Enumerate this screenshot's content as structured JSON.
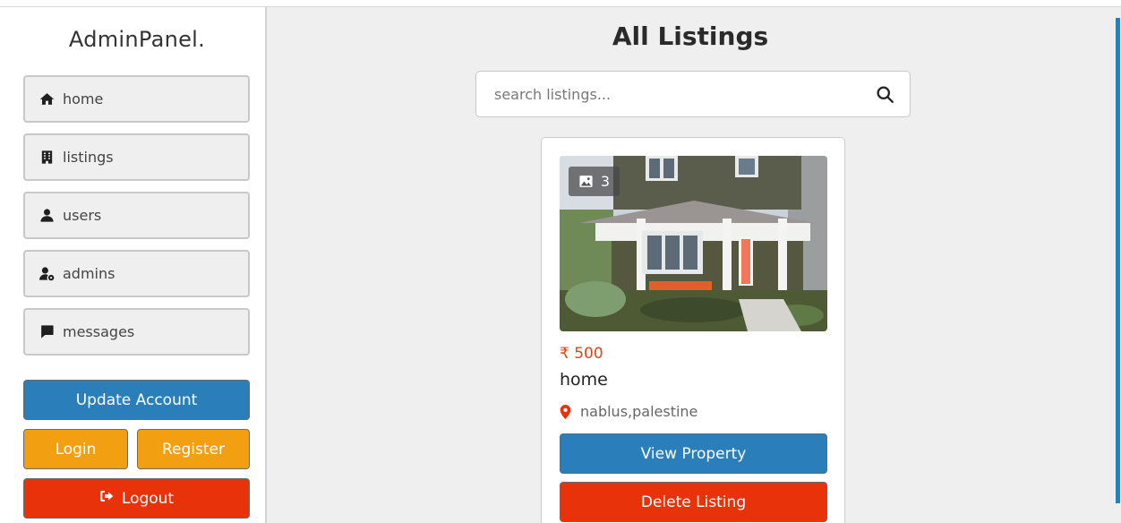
{
  "sidebar": {
    "logo": "AdminPanel.",
    "items": [
      {
        "label": "home",
        "icon": "home-icon"
      },
      {
        "label": "listings",
        "icon": "building-icon"
      },
      {
        "label": "users",
        "icon": "user-icon"
      },
      {
        "label": "admins",
        "icon": "user-gear-icon"
      },
      {
        "label": "messages",
        "icon": "message-icon"
      }
    ],
    "update_account": "Update Account",
    "login": "Login",
    "register": "Register",
    "logout": "Logout"
  },
  "main": {
    "title": "All Listings",
    "search": {
      "placeholder": "search listings...",
      "value": ""
    }
  },
  "listing": {
    "image_count": "3",
    "price_symbol": "₹",
    "price": "500",
    "title": "home",
    "location": "nablus,palestine",
    "view_label": "View Property",
    "delete_label": "Delete Listing"
  },
  "colors": {
    "blue": "#2a7fba",
    "orange": "#f2a012",
    "red": "#e8320a",
    "price": "#e24415"
  }
}
